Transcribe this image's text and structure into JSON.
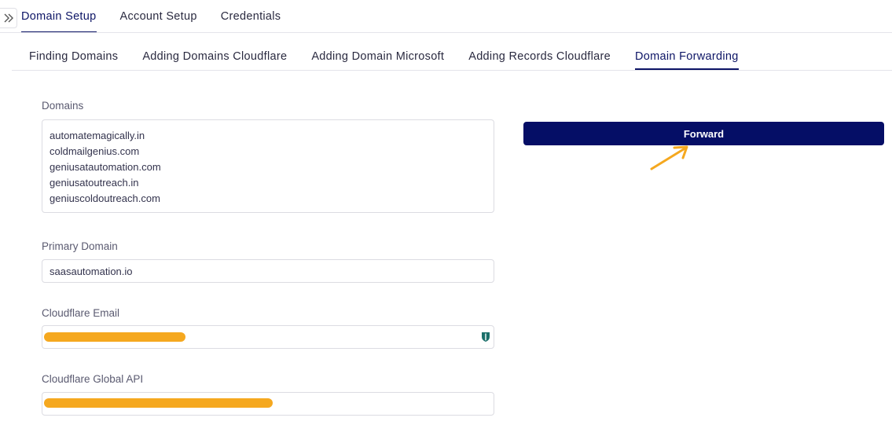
{
  "nav": {
    "top_tabs": [
      {
        "label": "Domain Setup",
        "active": true
      },
      {
        "label": "Account Setup",
        "active": false
      },
      {
        "label": "Credentials",
        "active": false
      }
    ],
    "sub_tabs": [
      {
        "label": "Finding Domains",
        "active": false
      },
      {
        "label": "Adding Domains Cloudflare",
        "active": false
      },
      {
        "label": "Adding Domain Microsoft",
        "active": false
      },
      {
        "label": "Adding Records Cloudflare",
        "active": false
      },
      {
        "label": "Domain Forwarding",
        "active": true
      }
    ]
  },
  "form": {
    "domains_label": "Domains",
    "domains": [
      "automatemagically.in",
      "coldmailgenius.com",
      "geniusatautomation.com",
      "geniusatoutreach.in",
      "geniuscoldoutreach.com"
    ],
    "primary_domain_label": "Primary Domain",
    "primary_domain_value": "saasautomation.io",
    "cloudflare_email_label": "Cloudflare Email",
    "cloudflare_api_label": "Cloudflare Global API"
  },
  "actions": {
    "forward_label": "Forward"
  },
  "colors": {
    "accent": "#050e66",
    "redaction": "#f5a81f",
    "annotation_arrow": "#f5a81f"
  }
}
